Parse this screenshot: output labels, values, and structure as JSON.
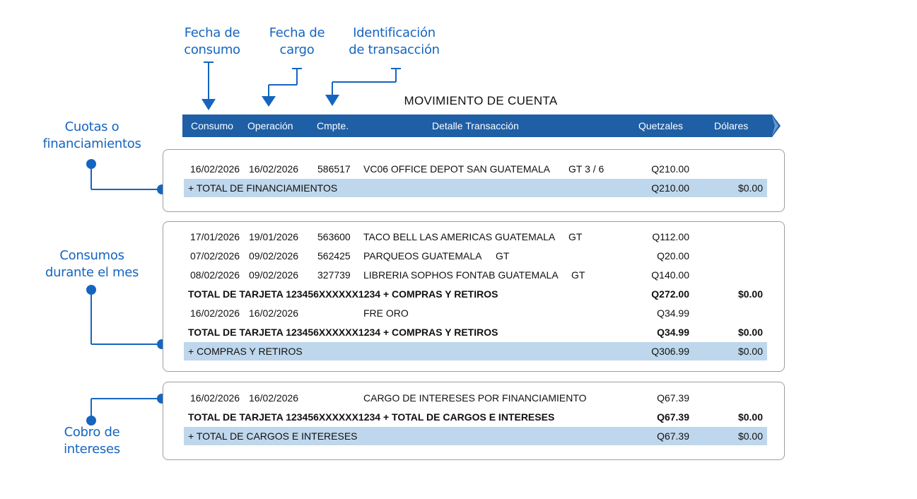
{
  "annotations": {
    "fecha_consumo": "Fecha de\nconsumo",
    "fecha_cargo": "Fecha de\ncargo",
    "identificacion": "Identificación\nde transacción",
    "cuotas": "Cuotas o\nfinanciamientos",
    "consumos": "Consumos\ndurante el mes",
    "cobro": "Cobro de\nintereses"
  },
  "title": "MOVIMIENTO DE CUENTA",
  "columns": {
    "consumo": "Consumo",
    "operacion": "Operación",
    "cmpte": "Cmpte.",
    "detalle": "Detalle Transacción",
    "quetzales": "Quetzales",
    "dolares": "Dólares"
  },
  "colors": {
    "accent": "#1565c0",
    "header_bg": "#1e5fa6",
    "total_bg": "#bfd7ec"
  },
  "sections": [
    {
      "rows": [
        {
          "consumo": "16/02/2026",
          "operacion": "16/02/2026",
          "cmpte": "586517",
          "detalle": "VC06 OFFICE DEPOT SAN  GUATEMALA",
          "extra": "GT 3 / 6",
          "q": "Q210.00",
          "d": ""
        },
        {
          "type": "total",
          "label": "+ TOTAL DE FINANCIAMIENTOS",
          "q": "Q210.00",
          "d": "$0.00"
        }
      ]
    },
    {
      "rows": [
        {
          "consumo": "17/01/2026",
          "operacion": "19/01/2026",
          "cmpte": "563600",
          "detalle": "TACO BELL LAS AMERICAS GUATEMALA",
          "extra": "GT",
          "q": "Q112.00",
          "d": ""
        },
        {
          "consumo": "07/02/2026",
          "operacion": "09/02/2026",
          "cmpte": "562425",
          "detalle": "PARQUEOS GUATEMALA",
          "extra": "GT",
          "q": "Q20.00",
          "d": ""
        },
        {
          "consumo": "08/02/2026",
          "operacion": "09/02/2026",
          "cmpte": "327739",
          "detalle": "LIBRERIA SOPHOS FONTAB GUATEMALA",
          "extra": "GT",
          "q": "Q140.00",
          "d": ""
        },
        {
          "type": "bold",
          "label": "TOTAL DE TARJETA 123456XXXXXX1234 + COMPRAS Y RETIROS",
          "q": "Q272.00",
          "d": "$0.00"
        },
        {
          "consumo": "16/02/2026",
          "operacion": "16/02/2026",
          "cmpte": "",
          "detalle": "FRE ORO",
          "extra": "",
          "q": "Q34.99",
          "d": ""
        },
        {
          "type": "bold",
          "label": "TOTAL DE TARJETA 123456XXXXXX1234 + COMPRAS Y RETIROS",
          "q": "Q34.99",
          "d": "$0.00"
        },
        {
          "type": "total",
          "label": "+ COMPRAS Y RETIROS",
          "q": "Q306.99",
          "d": "$0.00"
        }
      ]
    },
    {
      "rows": [
        {
          "consumo": "16/02/2026",
          "operacion": "16/02/2026",
          "cmpte": "",
          "detalle": "CARGO DE INTERESES POR FINANCIAMIENTO",
          "extra": "",
          "q": "Q67.39",
          "d": ""
        },
        {
          "type": "bold",
          "label": "TOTAL DE TARJETA 123456XXXXXX1234 + TOTAL DE CARGOS E INTERESES",
          "q": "Q67.39",
          "d": "$0.00"
        },
        {
          "type": "total",
          "label": "+ TOTAL DE CARGOS E INTERESES",
          "q": "Q67.39",
          "d": "$0.00"
        }
      ]
    }
  ]
}
